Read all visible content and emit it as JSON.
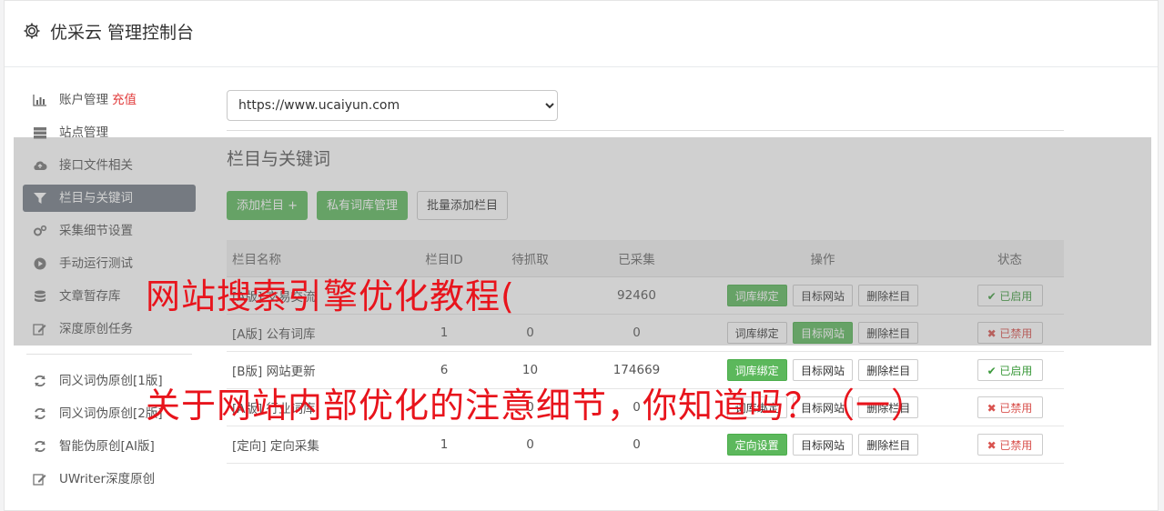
{
  "app": {
    "title": "优采云 管理控制台"
  },
  "sidebar": {
    "items": [
      {
        "label": "账户管理",
        "extra": "充值",
        "icon": "bar-chart-icon"
      },
      {
        "label": "站点管理",
        "icon": "server-icon"
      },
      {
        "label": "接口文件相关",
        "icon": "cloud-upload-icon"
      },
      {
        "label": "栏目与关键词",
        "icon": "filter-icon",
        "active": true
      },
      {
        "label": "采集细节设置",
        "icon": "gears-icon"
      },
      {
        "label": "手动运行测试",
        "icon": "play-circle-icon"
      },
      {
        "label": "文章暂存库",
        "icon": "database-icon"
      },
      {
        "label": "深度原创任务",
        "icon": "edit-icon"
      }
    ],
    "items2": [
      {
        "label": "同义词伪原创[1版]",
        "icon": "refresh-icon"
      },
      {
        "label": "同义词伪原创[2版]",
        "icon": "refresh-icon"
      },
      {
        "label": "智能伪原创[AI版]",
        "icon": "refresh-icon"
      },
      {
        "label": "UWriter深度原创",
        "icon": "edit-icon"
      }
    ]
  },
  "main": {
    "site_select": {
      "value": "https://www.ucaiyun.com"
    },
    "section_title": "栏目与关键词",
    "buttons": {
      "add_column": "添加栏目 +",
      "private_lib": "私有词库管理",
      "batch_add": "批量添加栏目"
    },
    "table": {
      "headers": [
        "栏目名称",
        "栏目ID",
        "待抓取",
        "已采集",
        "操作",
        "状态"
      ],
      "rows": [
        {
          "name": "[A版] 交易交流",
          "id": "",
          "pending": "",
          "collected": "92460",
          "actions": [
            "词库绑定",
            "目标网站",
            "删除栏目"
          ],
          "status": "✔ 已启用"
        },
        {
          "name": "[A版] 公有词库",
          "id": "1",
          "pending": "0",
          "collected": "0",
          "actions": [
            "词库绑定",
            "目标网站",
            "删除栏目"
          ],
          "status": "✖ 已禁用"
        },
        {
          "name": "[B版] 网站更新",
          "id": "6",
          "pending": "10",
          "collected": "174669",
          "actions": [
            "词库绑定",
            "目标网站",
            "删除栏目"
          ],
          "status": "✔ 已启用"
        },
        {
          "name": "[A版] 行业词库",
          "id": "",
          "pending": "0",
          "collected": "0",
          "actions": [
            "词库绑定",
            "目标网站",
            "删除栏目"
          ],
          "status": "✖ 已禁用"
        },
        {
          "name": "[定向] 定向采集",
          "id": "1",
          "pending": "0",
          "collected": "0",
          "actions": [
            "定向设置",
            "目标网站",
            "删除栏目"
          ],
          "status": "✖ 已禁用"
        }
      ]
    }
  },
  "watermarks": {
    "line1": "网站搜索引擎优化教程(",
    "line2": "关于网站内部优化的注意细节，你知道吗？（一）"
  }
}
